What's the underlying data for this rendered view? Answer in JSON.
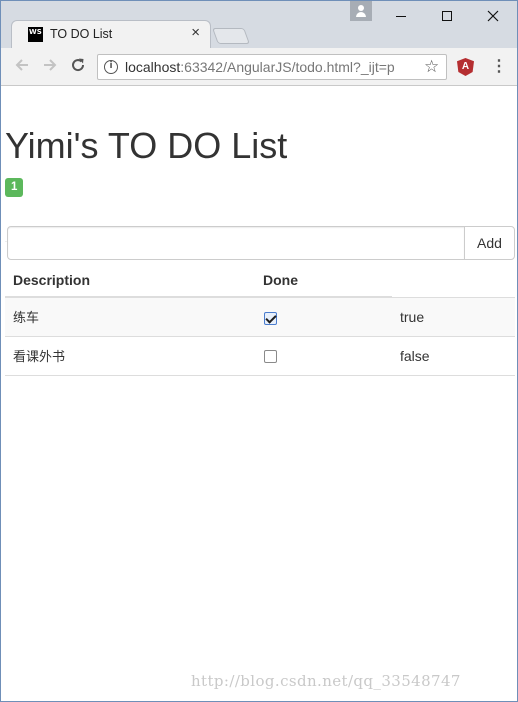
{
  "browser": {
    "tab_title": "TO DO List",
    "tab_close": "×",
    "tab_favicon_text": "WS",
    "url_host": "localhost",
    "url_rest": ":63342/AngularJS/todo.html?_ijt=p",
    "icons": [
      "user-icon",
      "back-icon",
      "forward-icon",
      "reload-icon",
      "info-icon",
      "star-icon",
      "angular-extension-icon",
      "menu-icon"
    ]
  },
  "page": {
    "title": "Yimi's TO DO List",
    "badge_count": "1",
    "add_input_value": "",
    "add_button_label": "Add",
    "table": {
      "headers": [
        "Description",
        "Done"
      ],
      "rows": [
        {
          "description": "练车",
          "done": true,
          "done_text": "true"
        },
        {
          "description": "看课外书",
          "done": false,
          "done_text": "false"
        }
      ]
    },
    "watermark": "http://blog.csdn.net/qq_33548747"
  },
  "colors": {
    "badge": "#5cb85c",
    "angular_icon": "#b52e31",
    "desktop": "#2b579a"
  }
}
